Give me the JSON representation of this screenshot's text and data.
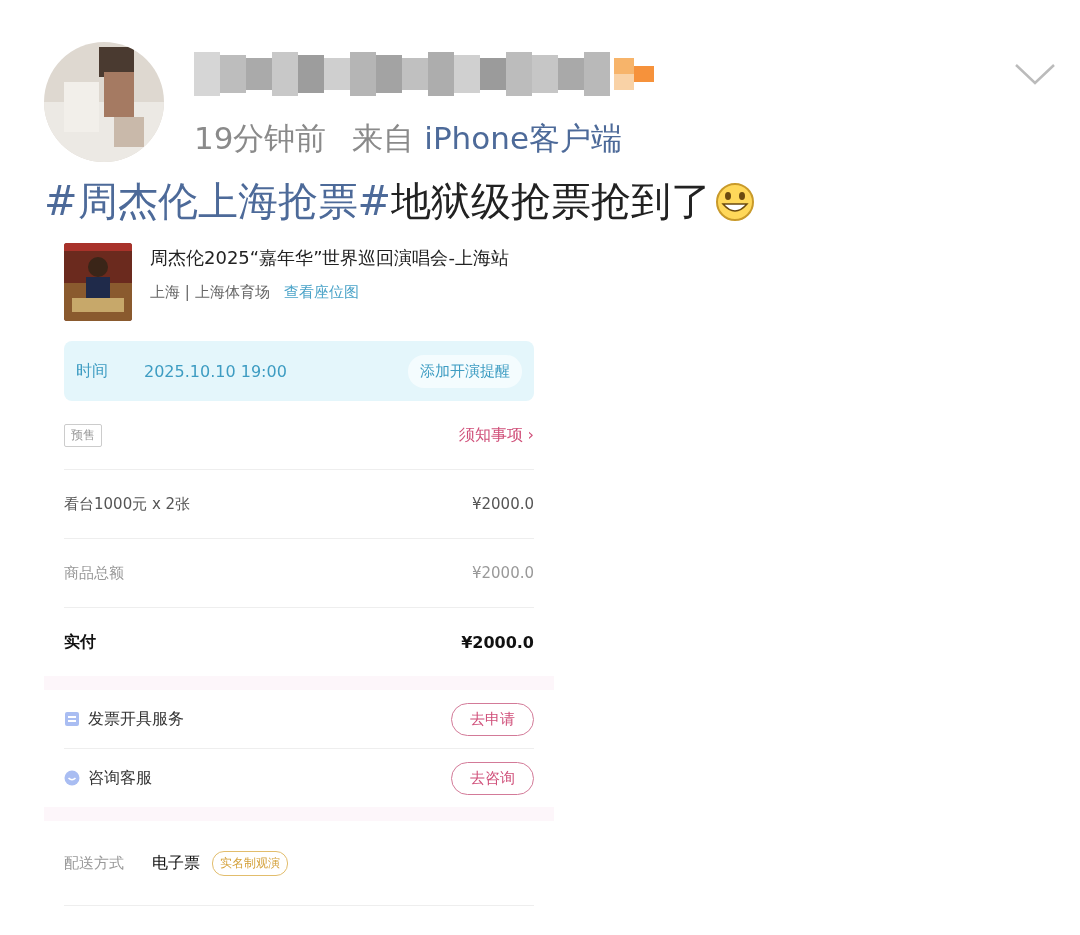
{
  "post": {
    "time": "19分钟前",
    "source_prefix": "来自",
    "source": "iPhone客户端",
    "text": [
      {
        "kind": "topic",
        "text": "#周杰伦上海抢票#"
      },
      {
        "kind": "plain",
        "text": "地狱级抢票抢到了"
      }
    ]
  },
  "order": {
    "title": "周杰伦2025“嘉年华”世界巡回演唱会-上海站",
    "venue": "上海 | 上海体育场",
    "seat_map_link": "查看座位图",
    "time_label": "时间",
    "time_value": "2025.10.10 19:00",
    "reminder_button": "添加开演提醒",
    "tag": "预售",
    "notice_link": "须知事项",
    "notice_arrow": "›",
    "lines": [
      {
        "kind": "item",
        "label": "看台1000元 x 2张",
        "value": "¥2000.0"
      },
      {
        "kind": "subtotal",
        "label": "商品总额",
        "value": "¥2000.0"
      },
      {
        "kind": "total",
        "label": "实付",
        "value": "¥2000.0"
      }
    ],
    "services": [
      {
        "kind": "invoice",
        "label": "发票开具服务",
        "button": "去申请"
      },
      {
        "kind": "chat",
        "label": "咨询客服",
        "button": "去咨询"
      }
    ],
    "delivery": {
      "label": "配送方式",
      "value": "电子票",
      "badge": "实名制观演"
    }
  }
}
